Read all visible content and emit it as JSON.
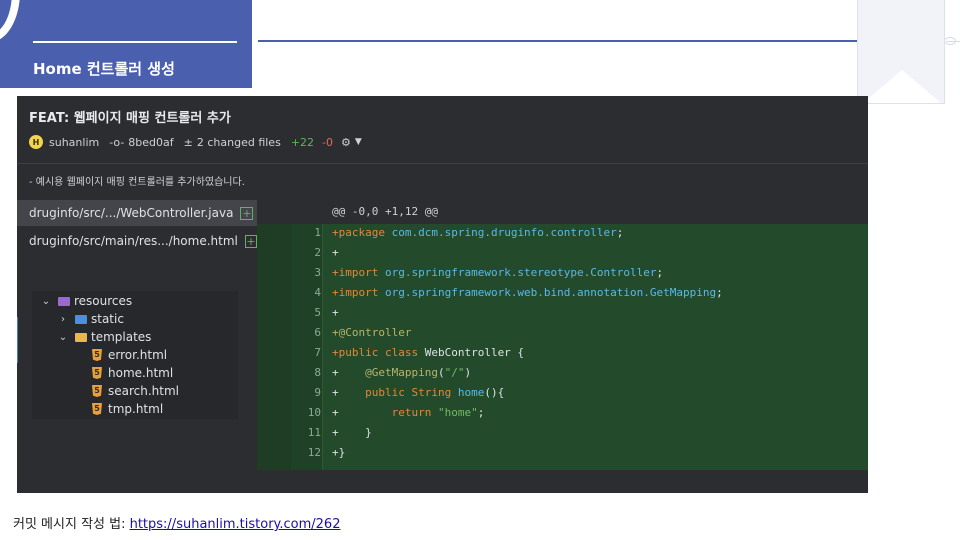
{
  "slide": {
    "title": "Home 컨트롤러 생성",
    "footer_label": "커밋 메시지 작성 법: ",
    "footer_link": "https://suhanlim.tistory.com/262"
  },
  "commit": {
    "title": "FEAT: 웹페이지 매핑 컨트롤러 추가",
    "avatar_letter": "H",
    "author": "suhanlim",
    "hash": "8bed0af",
    "changed_files": "2 changed files",
    "additions": "+22",
    "deletions": "-0",
    "description": "- 예시용 웹페이지 매핑 컨트롤러를 추가하였습니다."
  },
  "files": [
    {
      "path_prefix": "druginfo/src/.../",
      "name": "WebController.java",
      "status": "+"
    },
    {
      "path_prefix": "druginfo/src/main/res.../",
      "name": "home.html",
      "status": "+"
    }
  ],
  "tree": {
    "root": "resources",
    "folders": [
      "static",
      "templates"
    ],
    "files": [
      "error.html",
      "home.html",
      "search.html",
      "tmp.html"
    ]
  },
  "diff": {
    "hunk": "@@ -0,0 +1,12 @@",
    "line_numbers": [
      "1",
      "2",
      "3",
      "4",
      "5",
      "6",
      "7",
      "8",
      "9",
      "10",
      "11",
      "12"
    ]
  },
  "colors": {
    "accent": "#4a5fae",
    "added_bg": "#234b2b",
    "additions": "#5fb35f",
    "deletions": "#e06c55"
  },
  "icons": [
    "commit-icon",
    "changes-icon",
    "settings-icon",
    "file-added-icon",
    "folder-icon",
    "html-file-icon"
  ]
}
